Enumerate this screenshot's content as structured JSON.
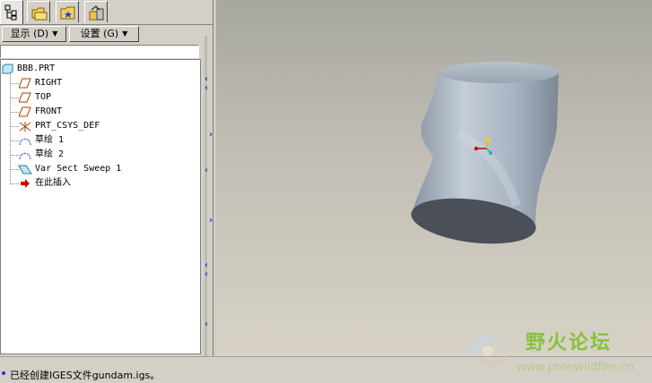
{
  "tabs": [
    {
      "icon": "model-tree-icon",
      "active": true
    },
    {
      "icon": "folder-browser-icon",
      "active": false
    },
    {
      "icon": "favorites-icon",
      "active": false
    },
    {
      "icon": "connections-icon",
      "active": false
    }
  ],
  "menu": {
    "display_label": "显示 (D)",
    "settings_label": "设置 (G)"
  },
  "tree": {
    "root": "BBB.PRT",
    "items": [
      {
        "label": "RIGHT",
        "icon": "datum-plane-icon"
      },
      {
        "label": "TOP",
        "icon": "datum-plane-icon"
      },
      {
        "label": "FRONT",
        "icon": "datum-plane-icon"
      },
      {
        "label": "PRT_CSYS_DEF",
        "icon": "coordinate-system-icon"
      },
      {
        "label": "草绘 1",
        "icon": "sketch-icon"
      },
      {
        "label": "草绘 2",
        "icon": "sketch-icon"
      },
      {
        "label": "Var Sect Sweep 1",
        "icon": "sweep-feature-icon"
      },
      {
        "label": "在此插入",
        "icon": "insert-here-arrow-icon"
      }
    ]
  },
  "status": {
    "message": "已经创建IGES文件gundam.igs。"
  },
  "watermark": {
    "title": "野火论坛",
    "url": "www.proewildfire.cn"
  },
  "colors": {
    "panel_bg": "#d4d0c8",
    "part_surface": "#a9b3c0",
    "part_end_cap": "#4b4f57",
    "accent_blue": "#1e3cc8",
    "watermark_green": "#86c23c"
  }
}
